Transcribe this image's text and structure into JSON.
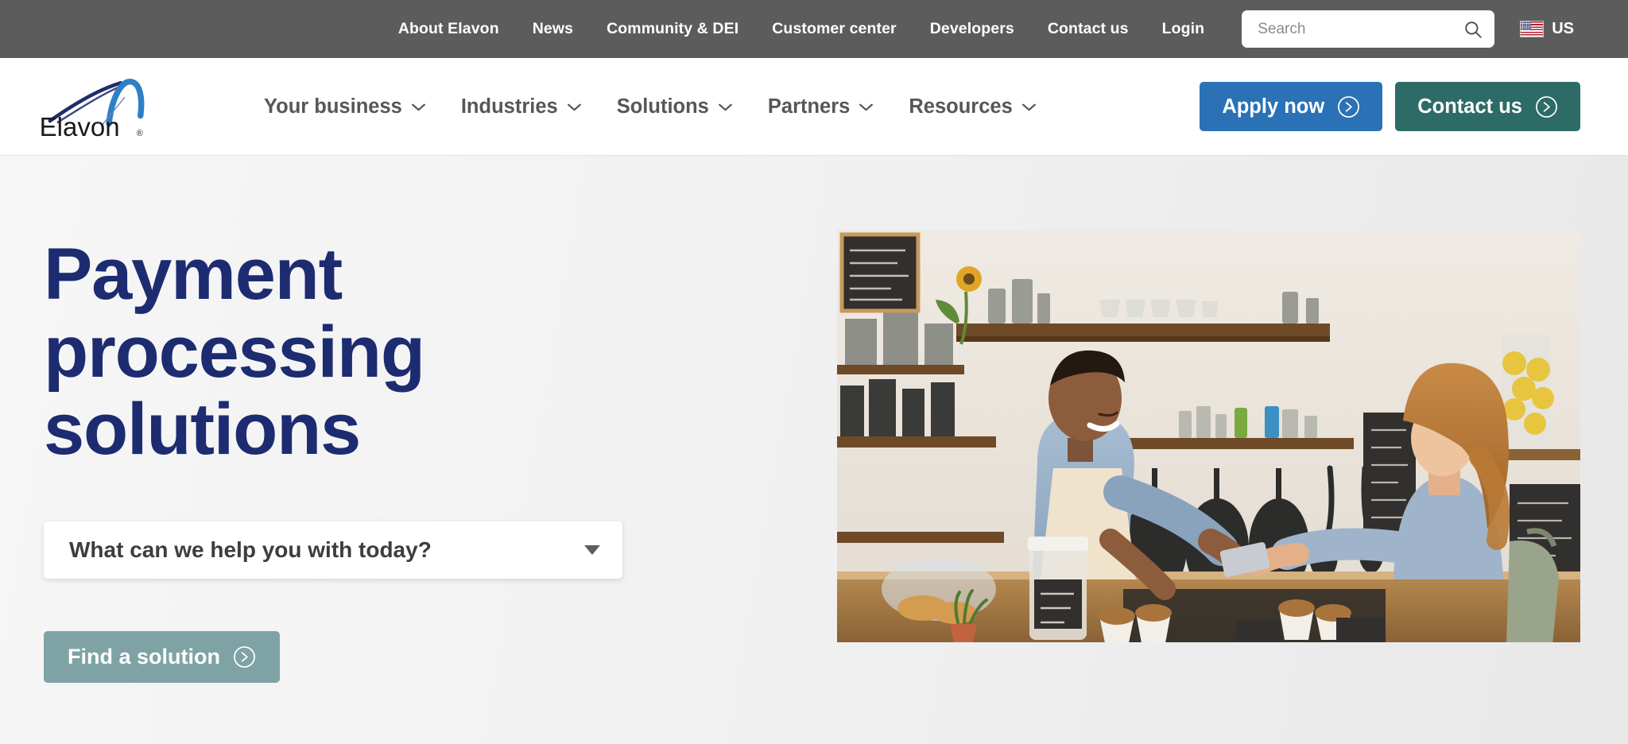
{
  "utility_bar": {
    "links": [
      {
        "label": "About Elavon",
        "name": "about-elavon"
      },
      {
        "label": "News",
        "name": "news"
      },
      {
        "label": "Community & DEI",
        "name": "community-dei"
      },
      {
        "label": "Customer center",
        "name": "customer-center"
      },
      {
        "label": "Developers",
        "name": "developers"
      },
      {
        "label": "Contact us",
        "name": "contact-us"
      },
      {
        "label": "Login",
        "name": "login"
      }
    ],
    "search": {
      "placeholder": "Search",
      "value": "",
      "icon": "search-icon"
    },
    "region": {
      "label": "US",
      "flag": "us-flag-icon"
    },
    "background_color": "#5c5c5c"
  },
  "header": {
    "logo": {
      "text": "Elavon",
      "trademark": "®",
      "name": "elavon-logo"
    },
    "nav": [
      {
        "label": "Your business",
        "icon": "chevron-down-icon"
      },
      {
        "label": "Industries",
        "icon": "chevron-down-icon"
      },
      {
        "label": "Solutions",
        "icon": "chevron-down-icon"
      },
      {
        "label": "Partners",
        "icon": "chevron-down-icon"
      },
      {
        "label": "Resources",
        "icon": "chevron-down-icon"
      }
    ],
    "cta_primary": {
      "label": "Apply now",
      "icon": "arrow-right-circle-icon",
      "color": "#2a72b5"
    },
    "cta_secondary": {
      "label": "Contact us",
      "icon": "arrow-right-circle-icon",
      "color": "#2d6b66"
    }
  },
  "hero": {
    "title": "Payment processing solutions",
    "title_color": "#1d2c71",
    "select": {
      "value": "What can we help you with today?",
      "icon": "caret-down-icon"
    },
    "cta": {
      "label": "Find a solution",
      "icon": "arrow-right-circle-icon",
      "color": "#7fa3a5"
    },
    "image": {
      "alt": "Barista handing a card terminal to a smiling customer at a cafe counter",
      "name": "hero-image"
    }
  }
}
